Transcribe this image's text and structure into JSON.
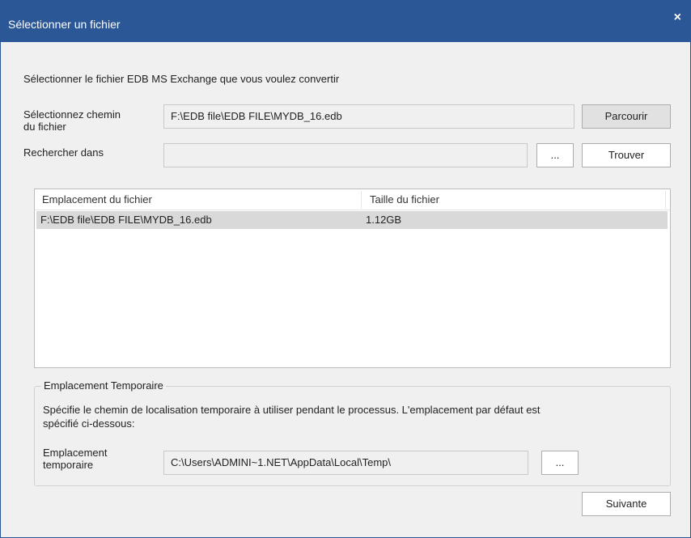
{
  "window": {
    "title": "Sélectionner un fichier",
    "close_glyph": "×"
  },
  "instruction": "Sélectionner le fichier EDB MS Exchange que vous voulez convertir",
  "path_row": {
    "label_line1": "Sélectionnez chemin",
    "label_line2": "du fichier",
    "value": "F:\\EDB file\\EDB FILE\\MYDB_16.edb",
    "browse_label": "Parcourir"
  },
  "search_row": {
    "label": "Rechercher dans",
    "value": "",
    "ellipsis_label": "...",
    "find_label": "Trouver"
  },
  "file_list": {
    "columns": [
      "Emplacement du fichier",
      "Taille du fichier"
    ],
    "rows": [
      {
        "location": "F:\\EDB file\\EDB FILE\\MYDB_16.edb",
        "size": "1.12GB"
      }
    ]
  },
  "temp_group": {
    "title": "Emplacement Temporaire",
    "description_line1": "Spécifie le chemin de localisation temporaire à utiliser pendant le processus. L'emplacement par défaut est",
    "description_line2": "spécifié ci-dessous:",
    "label_line1": "Emplacement",
    "label_line2": "temporaire",
    "value": "C:\\Users\\ADMINI~1.NET\\AppData\\Local\\Temp\\",
    "ellipsis_label": "..."
  },
  "next_label": "Suivante",
  "colors": {
    "titlebar": "#2b5797",
    "background": "#f0f0f0",
    "selected_row": "#d9d9d9"
  }
}
